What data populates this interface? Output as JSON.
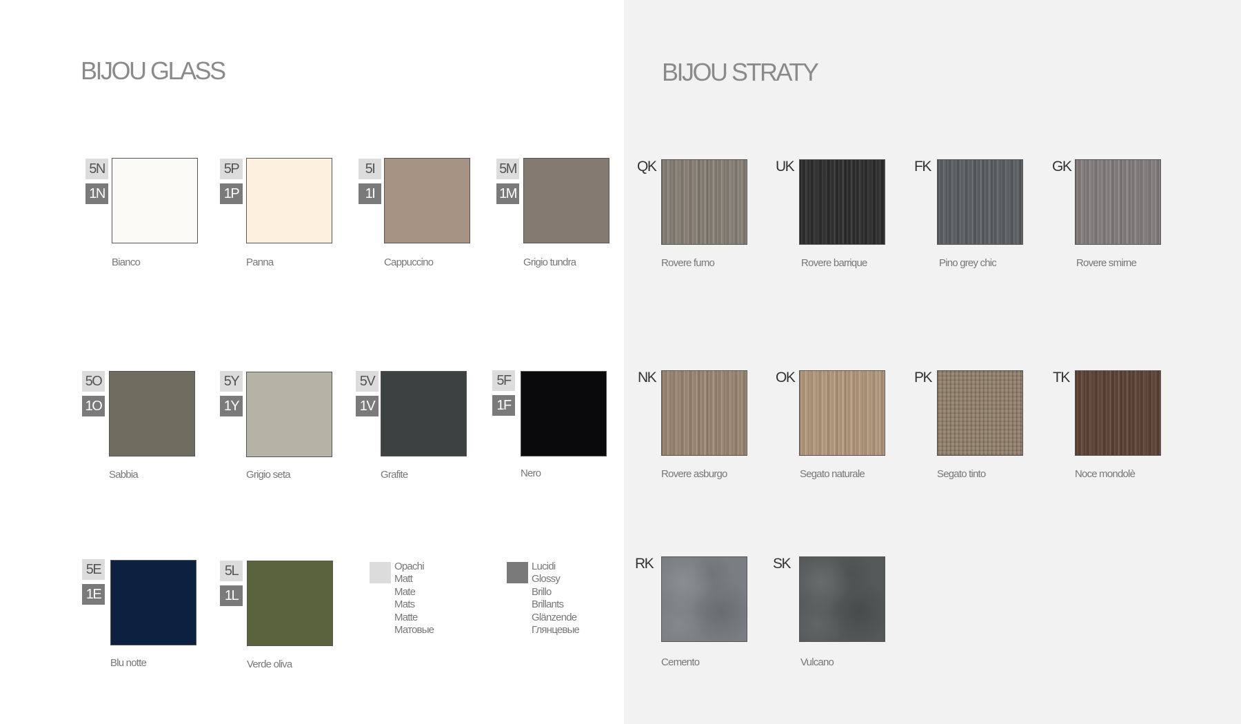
{
  "glass": {
    "title": "BIJOU GLASS",
    "items": [
      {
        "matt_code": "5N",
        "gloss_code": "1N",
        "label": "Bianco",
        "color": "#fbfaf6"
      },
      {
        "matt_code": "5P",
        "gloss_code": "1P",
        "label": "Panna",
        "color": "#fef0df"
      },
      {
        "matt_code": "5I",
        "gloss_code": "1I",
        "label": "Cappuccino",
        "color": "#a69283"
      },
      {
        "matt_code": "5M",
        "gloss_code": "1M",
        "label": "Grigio tundra",
        "color": "#857a72"
      },
      {
        "matt_code": "5O",
        "gloss_code": "1O",
        "label": "Sabbia",
        "color": "#6f6d5f"
      },
      {
        "matt_code": "5Y",
        "gloss_code": "1Y",
        "label": "Grigio seta",
        "color": "#b5b2a6"
      },
      {
        "matt_code": "5V",
        "gloss_code": "1V",
        "label": "Grafite",
        "color": "#3c4142"
      },
      {
        "matt_code": "5F",
        "gloss_code": "1F",
        "label": "Nero",
        "color": "#0a0a0c"
      },
      {
        "matt_code": "5E",
        "gloss_code": "1E",
        "label": "Blu notte",
        "color": "#0c2140"
      },
      {
        "matt_code": "5L",
        "gloss_code": "1L",
        "label": "Verde oliva",
        "color": "#5a633b"
      }
    ],
    "legend": {
      "matt": {
        "lines": [
          "Opachi",
          "Matt",
          "Mate",
          "Mats",
          "Matte",
          "Матовые"
        ],
        "color": "#dcdcdc"
      },
      "glossy": {
        "lines": [
          "Lucidi",
          "Glossy",
          "Brillo",
          "Brillants",
          "Glänzende",
          "Глянцевые"
        ],
        "color": "#7a7a7a"
      }
    }
  },
  "straty": {
    "title": "BIJOU STRATY",
    "items": [
      {
        "code": "QK",
        "label": "Rovere fumo",
        "color": "#8a8379",
        "texture": "wood"
      },
      {
        "code": "UK",
        "label": "Rovere barrique",
        "color": "#2e2e2e",
        "texture": "wood"
      },
      {
        "code": "FK",
        "label": "Pino grey chic",
        "color": "#5d6164",
        "texture": "wood"
      },
      {
        "code": "GK",
        "label": "Rovere smirne",
        "color": "#878180",
        "texture": "wood"
      },
      {
        "code": "NK",
        "label": "Rovere asburgo",
        "color": "#9e8a73",
        "texture": "wood"
      },
      {
        "code": "OK",
        "label": "Segato naturale",
        "color": "#b89c7f",
        "texture": "wood"
      },
      {
        "code": "PK",
        "label": "Segato tinto",
        "color": "#8e7c68",
        "texture": "wood-cross"
      },
      {
        "code": "TK",
        "label": "Noce mondolè",
        "color": "#5f4436",
        "texture": "wood"
      },
      {
        "code": "RK",
        "label": "Cemento",
        "color": "#7a7e83",
        "texture": "stone"
      },
      {
        "code": "SK",
        "label": "Vulcano",
        "color": "#545858",
        "texture": "stone"
      }
    ]
  }
}
